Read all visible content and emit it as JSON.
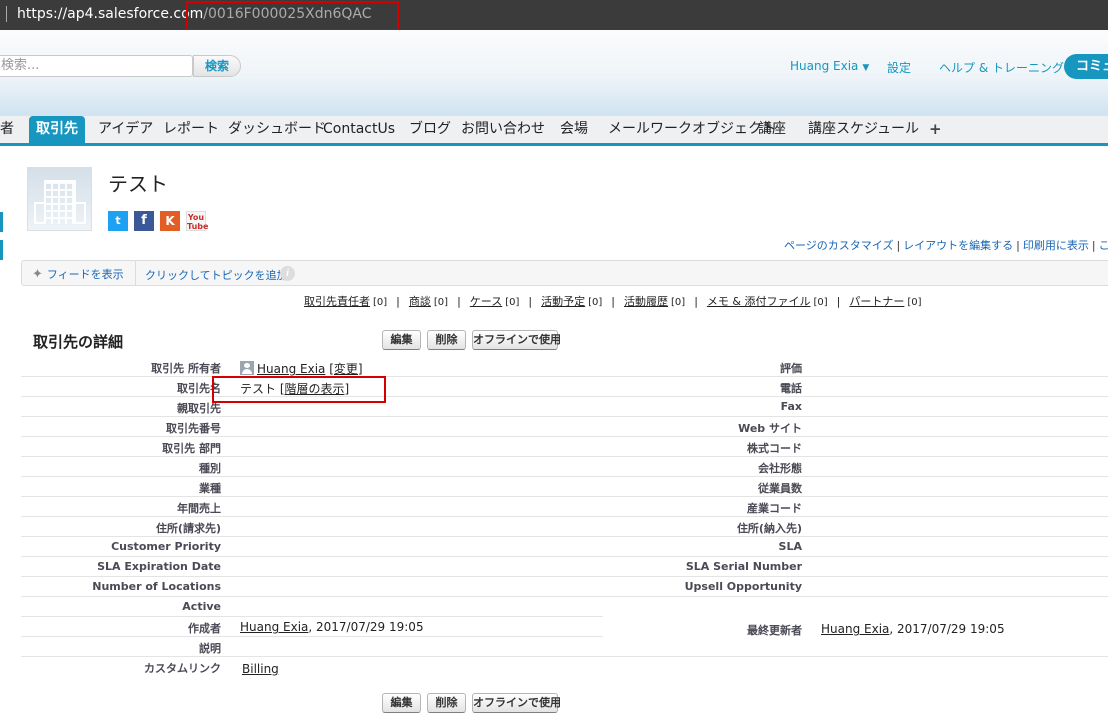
{
  "browser": {
    "url_host": "https://ap4.salesforce.com",
    "url_path": "/0016F000025Xdn6QAC"
  },
  "header": {
    "search_placeholder": "検索...",
    "search_button": "検索",
    "user_name": "Huang Exia",
    "user_caret": "▼",
    "settings": "設定",
    "help": "ヘルプ & トレーニング",
    "community_button": "コミュ"
  },
  "tabs": [
    {
      "label": "者"
    },
    {
      "label": "取引先"
    },
    {
      "label": "アイデア"
    },
    {
      "label": "レポート"
    },
    {
      "label": "ダッシュボード"
    },
    {
      "label": "ContactUs"
    },
    {
      "label": "ブログ"
    },
    {
      "label": "お問い合わせ"
    },
    {
      "label": "会場"
    },
    {
      "label": "メールワークオブジェクト"
    },
    {
      "label": "講座"
    },
    {
      "label": "講座スケジュール"
    },
    {
      "label": "+"
    }
  ],
  "account": {
    "name": "テスト",
    "social": {
      "twitter": "t",
      "facebook": "f",
      "klout": "K",
      "youtube_1": "You",
      "youtube_2": "Tube"
    }
  },
  "page_links": {
    "customize": "ページのカスタマイズ",
    "edit_layout": "レイアウトを編集する",
    "printable": "印刷用に表示",
    "help": "このペー"
  },
  "feed": {
    "show_feed": "フィードを表示",
    "add_topic": "クリックしてトピックを追加:",
    "info": "i"
  },
  "related_lists": [
    {
      "label": "取引先責任者",
      "count": "[0]"
    },
    {
      "label": "商談",
      "count": "[0]"
    },
    {
      "label": "ケース",
      "count": "[0]"
    },
    {
      "label": "活動予定",
      "count": "[0]"
    },
    {
      "label": "活動履歴",
      "count": "[0]"
    },
    {
      "label": "メモ & 添付ファイル",
      "count": "[0]"
    },
    {
      "label": "パートナー",
      "count": "[0]"
    }
  ],
  "detail": {
    "title": "取引先の詳細",
    "buttons": {
      "edit": "編集",
      "delete": "削除",
      "offline": "オフラインで使用"
    },
    "owner_label": "取引先 所有者",
    "owner_name": "Huang Exia",
    "owner_change": "[変更]",
    "name_label": "取引先名",
    "name_value": "テスト",
    "hierarchy_link": "[階層の表示]",
    "parent_label": "親取引先",
    "number_label": "取引先番号",
    "site_label": "取引先 部門",
    "type_label": "種別",
    "industry_label": "業種",
    "revenue_label": "年間売上",
    "billing_label": "住所(請求先)",
    "priority_label": "Customer Priority",
    "sla_exp_label": "SLA Expiration Date",
    "locations_label": "Number of Locations",
    "active_label": "Active",
    "created_label": "作成者",
    "created_user": "Huang Exia",
    "created_date": ", 2017/07/29 19:05",
    "description_label": "説明",
    "custom_links_label": "カスタムリンク",
    "billing_link": "Billing",
    "rating_label": "評価",
    "phone_label": "電話",
    "fax_label": "Fax",
    "website_label": "Web サイト",
    "ticker_label": "株式コード",
    "ownership_label": "会社形態",
    "employees_label": "従業員数",
    "sic_label": "産業コード",
    "shipping_label": "住所(納入先)",
    "sla_label": "SLA",
    "sla_serial_label": "SLA Serial Number",
    "upsell_label": "Upsell Opportunity",
    "modified_label": "最終更新者",
    "modified_user": "Huang Exia",
    "modified_date": ", 2017/07/29 19:05"
  },
  "colors": {
    "accent": "#1797c0",
    "highlight": "#d40000"
  }
}
